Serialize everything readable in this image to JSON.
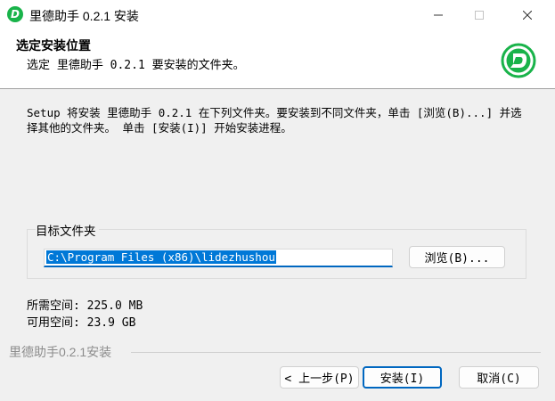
{
  "window": {
    "title": "里德助手 0.2.1 安装",
    "icon": "lidezhushou-app-icon",
    "icon_letter": "D"
  },
  "header": {
    "title": "选定安装位置",
    "subtitle": "选定 里德助手 0.2.1 要安装的文件夹。"
  },
  "description": "Setup 将安装 里德助手 0.2.1 在下列文件夹。要安装到不同文件夹，单击 [浏览(B)...] 并选择其他的文件夹。 单击 [安装(I)] 开始安装进程。",
  "destination": {
    "group_label": "目标文件夹",
    "path": "C:\\Program Files (x86)\\lidezhushou",
    "browse_label": "浏览(B)..."
  },
  "space": {
    "required": "所需空间: 225.0 MB",
    "available": "可用空间: 23.9 GB"
  },
  "branding": "里德助手0.2.1安装",
  "buttons": {
    "back": "< 上一步(P)",
    "install": "安装(I)",
    "cancel": "取消(C)"
  },
  "colors": {
    "brand_green": "#19b34a",
    "accent_blue": "#0067c0",
    "selection_blue": "#0078d7"
  }
}
